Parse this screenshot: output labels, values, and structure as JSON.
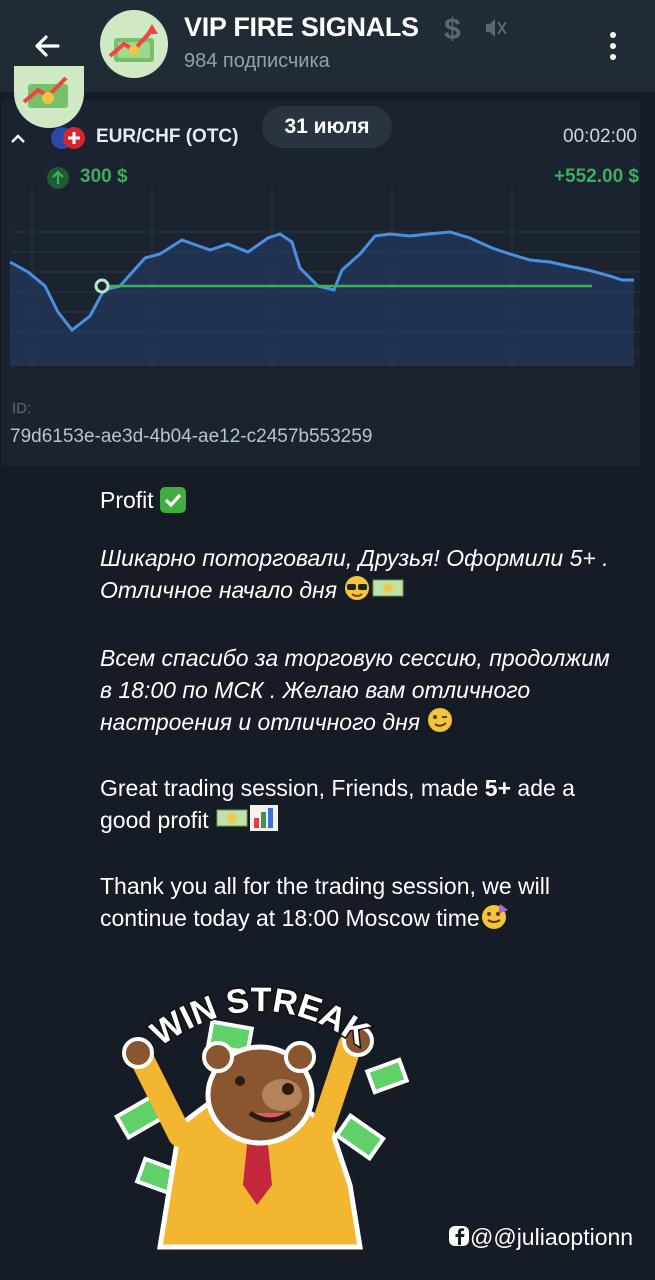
{
  "header": {
    "channel_name": "VIP FIRE SIGNALS",
    "subscribers": "984 подписчика",
    "back_icon": "arrow-left-icon",
    "menu_icon": "more-vertical-icon",
    "status_icons": [
      "dollar-icon",
      "mute-icon"
    ]
  },
  "date_pill": "31 июля",
  "trade_card": {
    "pair": "EUR/CHF (OTC)",
    "timer": "00:02:00",
    "amount": "300 $",
    "profit": "+552.00 $",
    "id_label": "ID:",
    "id_value": "79d6153e-ae3d-4b04-ae12-c2457b553259",
    "colors": {
      "line": "#4a90e2",
      "entry": "#3fae5c",
      "card": "#1b2230"
    }
  },
  "message": {
    "profit_title": "Profit",
    "ru_p1": "Шикарно поторговали, Друзья! Оформили 5+ . Отличное начало дня",
    "ru_p2": "Всем спасибо за торговую сессию, продолжим в 18:00 по МСК . Желаю вам отличного настроения и отличного дня",
    "en_p1_a": "Great trading session, Friends, made ",
    "en_p1_b": "5+",
    "en_p1_c": " ade a good profit",
    "en_p2": "Thank you all for the trading session, we will continue today at 18:00 Moscow time"
  },
  "sticker": {
    "caption": "WIN STREAK"
  },
  "watermark": "@@juliaoptionn"
}
